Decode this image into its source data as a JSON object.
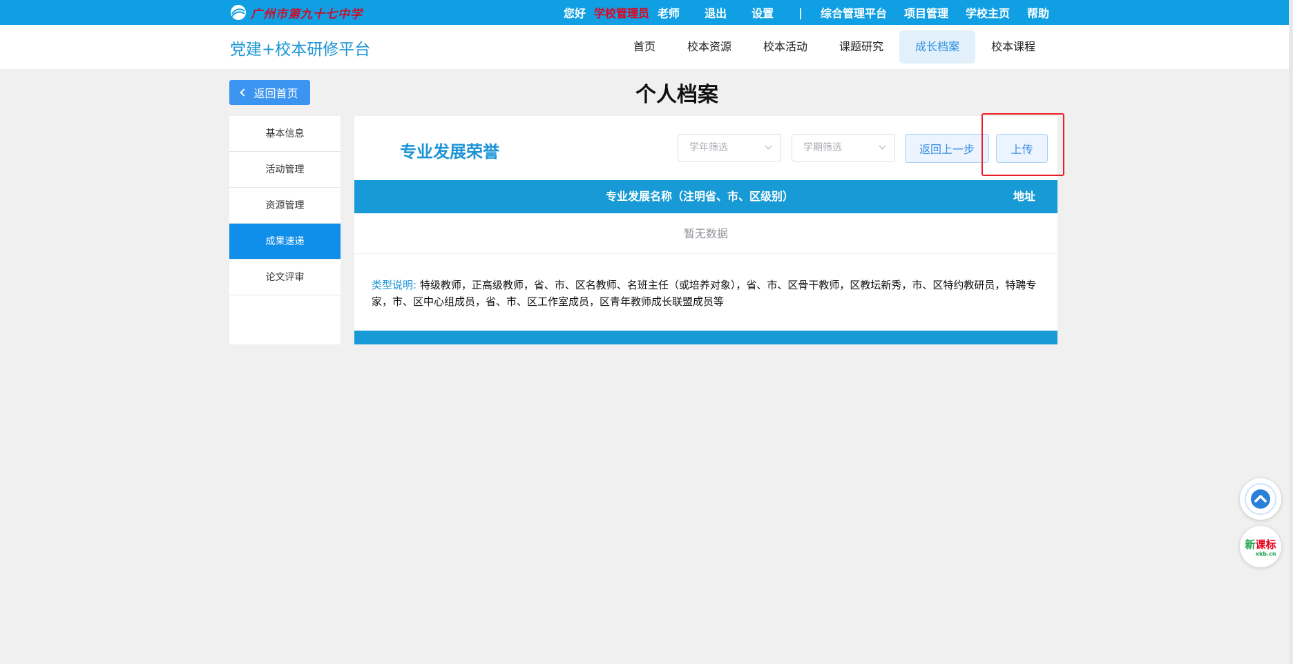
{
  "topbar": {
    "school_logo_text": "广州市第九十七中学",
    "greeting": "您好",
    "role": "学校管理员",
    "teacher": "老师",
    "logout": "退出",
    "settings": "设置",
    "separator": "|",
    "links": [
      "综合管理平台",
      "项目管理",
      "学校主页",
      "帮助"
    ]
  },
  "header": {
    "brand": "党建+校本研修平台",
    "nav": [
      {
        "label": "首页",
        "active": false
      },
      {
        "label": "校本资源",
        "active": false
      },
      {
        "label": "校本活动",
        "active": false
      },
      {
        "label": "课题研究",
        "active": false
      },
      {
        "label": "成长档案",
        "active": true
      },
      {
        "label": "校本课程",
        "active": false
      }
    ]
  },
  "page": {
    "back_home": "返回首页",
    "title": "个人档案"
  },
  "sidebar": {
    "items": [
      {
        "label": "基本信息",
        "active": false
      },
      {
        "label": "活动管理",
        "active": false
      },
      {
        "label": "资源管理",
        "active": false
      },
      {
        "label": "成果速递",
        "active": true
      },
      {
        "label": "论文评审",
        "active": false
      }
    ]
  },
  "panel": {
    "section_title": "专业发展荣誉",
    "year_filter_placeholder": "学年筛选",
    "term_filter_placeholder": "学期筛选",
    "back_step": "返回上一步",
    "upload": "上传",
    "table": {
      "columns": [
        "专业发展名称（注明省、市、区级别）",
        "地址"
      ],
      "empty_text": "暂无数据"
    },
    "note_label": "类型说明:",
    "note_text": "特级教师，正高级教师，省、市、区名教师、名班主任（或培养对象），省、市、区骨干教师，区教坛新秀，市、区特约教研员，特聘专家，市、区中心组成员，省、市、区工作室成员，区青年教师成长联盟成员等"
  },
  "fab": {
    "logo_text_green": "新",
    "logo_text_red": "课标",
    "logo_site": "xkb.cn"
  },
  "colors": {
    "topbar": "#0f9fe2",
    "accent": "#1a94d6",
    "active_sidebar": "#0f8eea",
    "highlight": "#ee1c24"
  }
}
